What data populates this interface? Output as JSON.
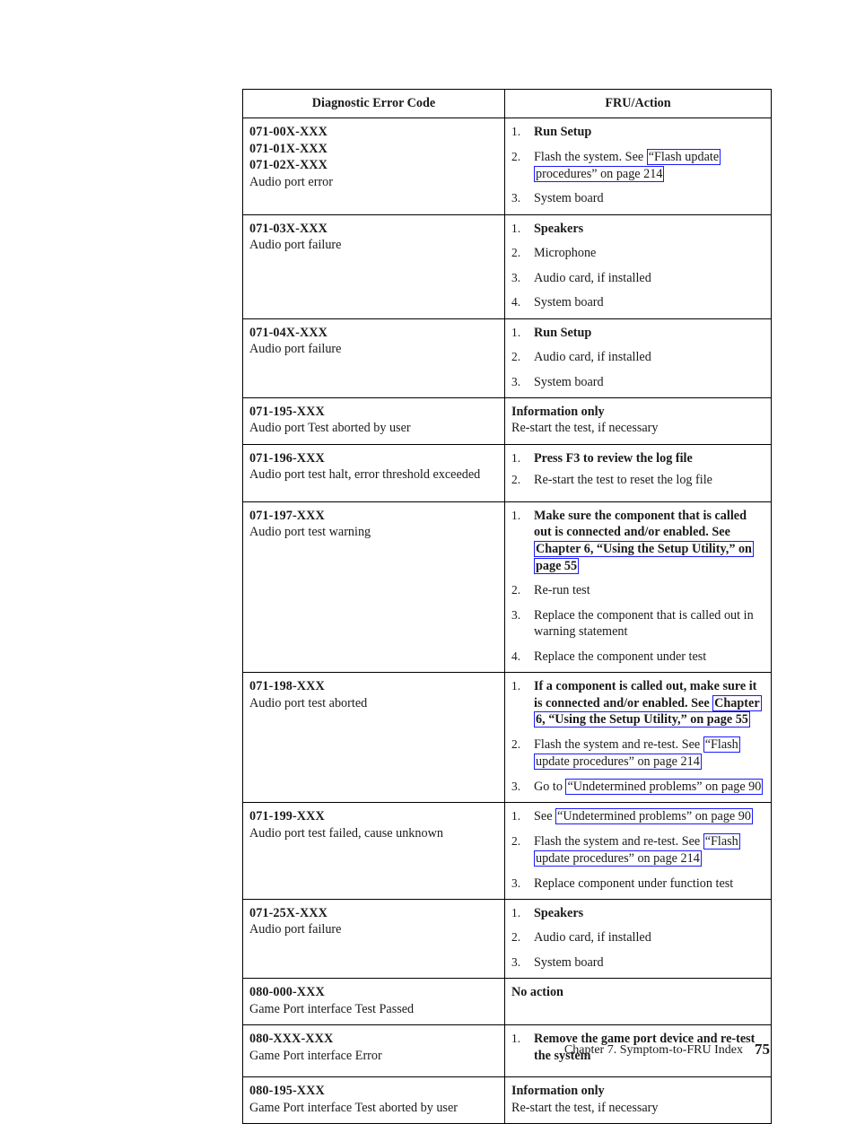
{
  "page": {
    "footer_chapter": "Chapter 7. Symptom-to-FRU Index",
    "footer_page_number": "75",
    "link_border_color": "#1a1aff"
  },
  "table": {
    "headers": {
      "code": "Diagnostic Error Code",
      "action": "FRU/Action"
    },
    "rows": [
      {
        "codes": [
          "071-00X-XXX",
          "071-01X-XXX",
          "071-02X-XXX"
        ],
        "description": "Audio port error",
        "actions": [
          {
            "bold": true,
            "pre": "Run Setup",
            "link": "",
            "post": ""
          },
          {
            "bold": false,
            "pre": "Flash the system. See ",
            "link": "“Flash update procedures” on page 214",
            "post": ""
          },
          {
            "bold": false,
            "pre": "System board",
            "link": "",
            "post": ""
          }
        ]
      },
      {
        "codes": [
          "071-03X-XXX"
        ],
        "description": "Audio port failure",
        "actions": [
          {
            "bold": true,
            "pre": "Speakers",
            "link": "",
            "post": ""
          },
          {
            "bold": false,
            "pre": "Microphone",
            "link": "",
            "post": ""
          },
          {
            "bold": false,
            "pre": "Audio card, if installed",
            "link": "",
            "post": ""
          },
          {
            "bold": false,
            "pre": "System board",
            "link": "",
            "post": ""
          }
        ]
      },
      {
        "codes": [
          "071-04X-XXX"
        ],
        "description": "Audio port failure",
        "actions": [
          {
            "bold": true,
            "pre": "Run Setup",
            "link": "",
            "post": ""
          },
          {
            "bold": false,
            "pre": "Audio card, if installed",
            "link": "",
            "post": ""
          },
          {
            "bold": false,
            "pre": "System board",
            "link": "",
            "post": ""
          }
        ]
      },
      {
        "codes": [
          "071-195-XXX"
        ],
        "description": "Audio port Test aborted by user",
        "info_head": "Information only",
        "info_sub": "Re-start the test, if necessary",
        "actions": []
      },
      {
        "codes": [
          "071-196-XXX"
        ],
        "description": "Audio port test halt, error threshold exceeded",
        "actions": [
          {
            "bold": true,
            "pre": "Press F3 to review the log file",
            "link": "",
            "post": ""
          },
          {
            "bold": false,
            "pre": "Re-start the test to reset the log file",
            "link": "",
            "post": ""
          }
        ]
      },
      {
        "codes": [
          "071-197-XXX"
        ],
        "description": "Audio port test warning",
        "actions": [
          {
            "bold": true,
            "pre": "Make sure the component that is called out is connected and/or enabled. See ",
            "link": "Chapter 6, “Using the Setup Utility,” on page 55",
            "post": ""
          },
          {
            "bold": false,
            "pre": "Re-run test",
            "link": "",
            "post": ""
          },
          {
            "bold": false,
            "pre": "Replace the component that is called out in warning statement",
            "link": "",
            "post": ""
          },
          {
            "bold": false,
            "pre": "Replace the component under test",
            "link": "",
            "post": ""
          }
        ]
      },
      {
        "codes": [
          "071-198-XXX"
        ],
        "description": "Audio port test aborted",
        "actions": [
          {
            "bold": true,
            "pre": "If a component is called out, make sure it is connected and/or enabled. See ",
            "link": "Chapter 6, “Using the Setup Utility,” on page 55",
            "post": ""
          },
          {
            "bold": false,
            "pre": "Flash the system and re-test. See ",
            "link": "“Flash update procedures” on page 214",
            "post": ""
          },
          {
            "bold": false,
            "pre": "Go to ",
            "link": "“Undetermined problems” on page 90",
            "post": ""
          }
        ]
      },
      {
        "codes": [
          "071-199-XXX"
        ],
        "description": "Audio port test failed, cause unknown",
        "actions": [
          {
            "bold": false,
            "pre": "See ",
            "link": "“Undetermined problems” on page 90",
            "post": ""
          },
          {
            "bold": false,
            "pre": "Flash the system and re-test. See ",
            "link": "“Flash update procedures” on page 214",
            "post": ""
          },
          {
            "bold": false,
            "pre": "Replace component under function test",
            "link": "",
            "post": ""
          }
        ]
      },
      {
        "codes": [
          "071-25X-XXX"
        ],
        "description": "Audio port failure",
        "actions": [
          {
            "bold": true,
            "pre": "Speakers",
            "link": "",
            "post": ""
          },
          {
            "bold": false,
            "pre": "Audio card, if installed",
            "link": "",
            "post": ""
          },
          {
            "bold": false,
            "pre": "System board",
            "link": "",
            "post": ""
          }
        ]
      },
      {
        "codes": [
          "080-000-XXX"
        ],
        "description": "Game Port interface Test Passed",
        "info_head": "No action",
        "info_sub": "",
        "actions": []
      },
      {
        "codes": [
          "080-XXX-XXX"
        ],
        "description": "Game Port interface Error",
        "actions": [
          {
            "bold": true,
            "pre": "Remove the game port device and re-test the system",
            "link": "",
            "post": ""
          }
        ]
      },
      {
        "codes": [
          "080-195-XXX"
        ],
        "description": "Game Port interface Test aborted by user",
        "info_head": "Information only",
        "info_sub": "Re-start the test, if necessary",
        "actions": []
      }
    ]
  }
}
